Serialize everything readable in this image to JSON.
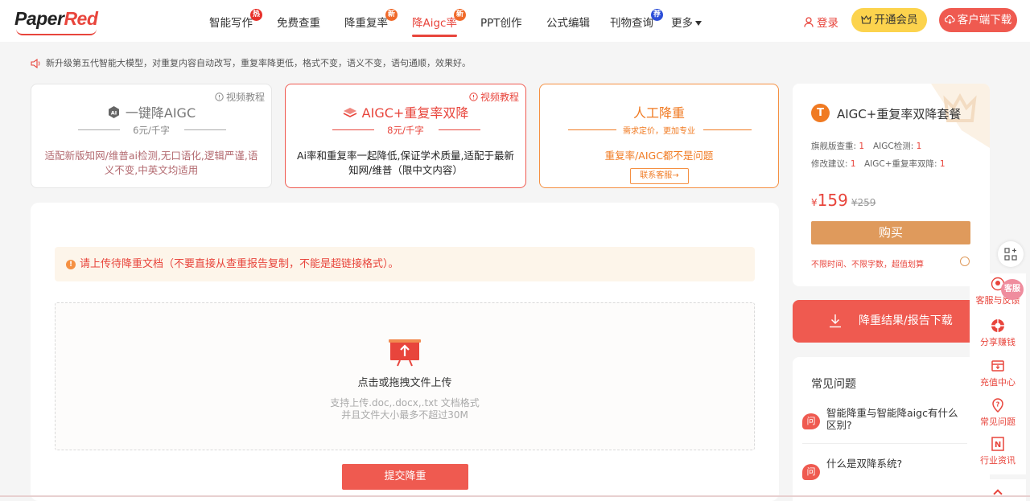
{
  "header": {
    "logo": {
      "part1": "Paper",
      "part2": "Red"
    },
    "nav": [
      {
        "label": "智能写作",
        "badge": "热"
      },
      {
        "label": "免费查重",
        "badge": ""
      },
      {
        "label": "降重复率",
        "badge": "新"
      },
      {
        "label": "降Aigc率",
        "badge": "新",
        "active": true
      },
      {
        "label": "PPT创作",
        "badge": ""
      },
      {
        "label": "公式编辑",
        "badge": ""
      },
      {
        "label": "刊物查询",
        "badge": "荐"
      },
      {
        "label": "更多",
        "badge": ""
      }
    ],
    "login": "登录",
    "vip": "开通会员",
    "client": "客户端下载"
  },
  "notice": "新升级第五代智能大模型，对重复内容自动改写，重复率降更低，格式不变，语义不变，语句通顺，效果好。",
  "cards": [
    {
      "video": "视频教程",
      "title": "一键降AIGC",
      "price": "6元/千字",
      "desc": "适配新版知网/维普ai检测,无口语化,逻辑严谨,语义不变,中英文均适用"
    },
    {
      "video": "视频教程",
      "title": "AIGC+重复率双降",
      "price": "8元/千字",
      "desc": "Ai率和重复率一起降低,保证学术质量,适配于最新知网/维普（限中文内容）"
    },
    {
      "title": "人工降重",
      "price": "需求定价，更加专业",
      "desc": "重复率/AIGC都不是问题",
      "contact": "联系客服→"
    }
  ],
  "upload": {
    "warning": "请上传待降重文档（不要直接从查重报告复制，不能是超链接格式）。",
    "main": "点击或拖拽文件上传",
    "sub1": "支持上传.doc,.docx,.txt 文档格式",
    "sub2": "并且文件大小最多不超过30M",
    "submit": "提交降重"
  },
  "package": {
    "icon": "T",
    "title": "AIGC+重复率双降套餐",
    "rows": [
      [
        {
          "label": "旗舰版查重: ",
          "value": "1"
        },
        {
          "label": "AIGC检测: ",
          "value": "1"
        }
      ],
      [
        {
          "label": "修改建议: ",
          "value": "1"
        },
        {
          "label": "AIGC+重复率双降: ",
          "value": "1"
        }
      ]
    ],
    "currency": "¥",
    "price": "159",
    "old_price": "¥259",
    "buy": "购买",
    "note": "不限时间、不限字数，超值划算"
  },
  "download": "降重结果/报告下载",
  "faq": {
    "title": "常见问题",
    "icon": "问",
    "items": [
      "智能降重与智能降aigc有什么区别?",
      "什么是双降系统?"
    ]
  },
  "rail": {
    "avatar": "客服",
    "items": [
      "客服与反馈",
      "分享赚钱",
      "充值中心",
      "常见问题",
      "行业资讯"
    ]
  },
  "colors": {
    "brand": "#ef5a50",
    "accent_orange": "#f07a22",
    "vip_yellow": "#fcd34d",
    "buy_tan": "#df9a5c"
  }
}
